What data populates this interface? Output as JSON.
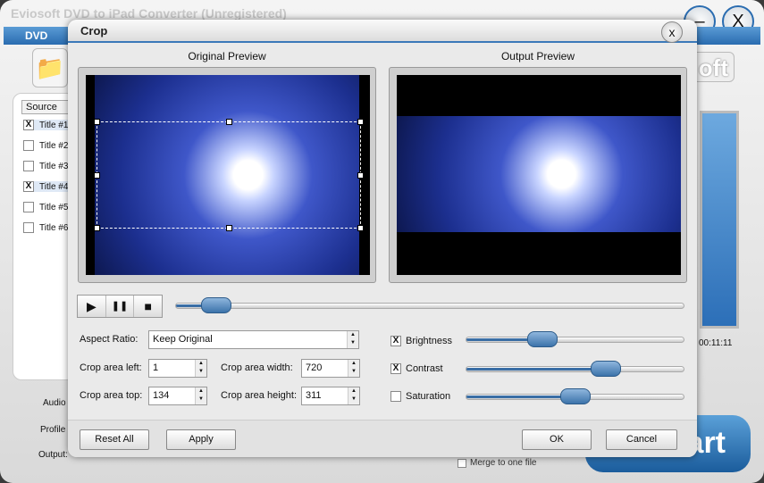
{
  "app": {
    "title": "Eviosoft DVD to iPad Converter (Unregistered)",
    "menu_dvd": "DVD",
    "minimize": "–",
    "close": "X",
    "brand_fragment": "oft",
    "source_header": "Source",
    "titles": [
      {
        "label": "Title #1",
        "checked": true
      },
      {
        "label": "Title #2",
        "checked": false
      },
      {
        "label": "Title #3",
        "checked": false
      },
      {
        "label": "Title #4",
        "checked": true
      },
      {
        "label": "Title #5",
        "checked": false
      },
      {
        "label": "Title #6",
        "checked": false
      }
    ],
    "audio_label": "Audio",
    "profile_label": "Profile",
    "output_label": "Output:",
    "time": "00:11:11",
    "merge_label": "Merge to one file",
    "start_label": "Start"
  },
  "dialog": {
    "title": "Crop",
    "close": "x",
    "original_preview": "Original Preview",
    "output_preview": "Output Preview",
    "playback": {
      "play": "▶",
      "pause": "❚❚",
      "stop": "■",
      "position_percent": 8
    },
    "aspect_ratio_label": "Aspect Ratio:",
    "aspect_ratio_value": "Keep Original",
    "crop_left_label": "Crop area left:",
    "crop_left": "1",
    "crop_width_label": "Crop area width:",
    "crop_width": "720",
    "crop_top_label": "Crop area top:",
    "crop_top": "134",
    "crop_height_label": "Crop area height:",
    "crop_height": "311",
    "brightness": {
      "label": "Brightness",
      "checked": true,
      "value_percent": 35
    },
    "contrast": {
      "label": "Contrast",
      "checked": true,
      "value_percent": 64
    },
    "saturation": {
      "label": "Saturation",
      "checked": false,
      "value_percent": 50
    },
    "reset_all": "Reset All",
    "apply": "Apply",
    "ok": "OK",
    "cancel": "Cancel"
  },
  "colors": {
    "accent": "#2a6cb0",
    "slider_thumb": "#5a8fc4"
  }
}
